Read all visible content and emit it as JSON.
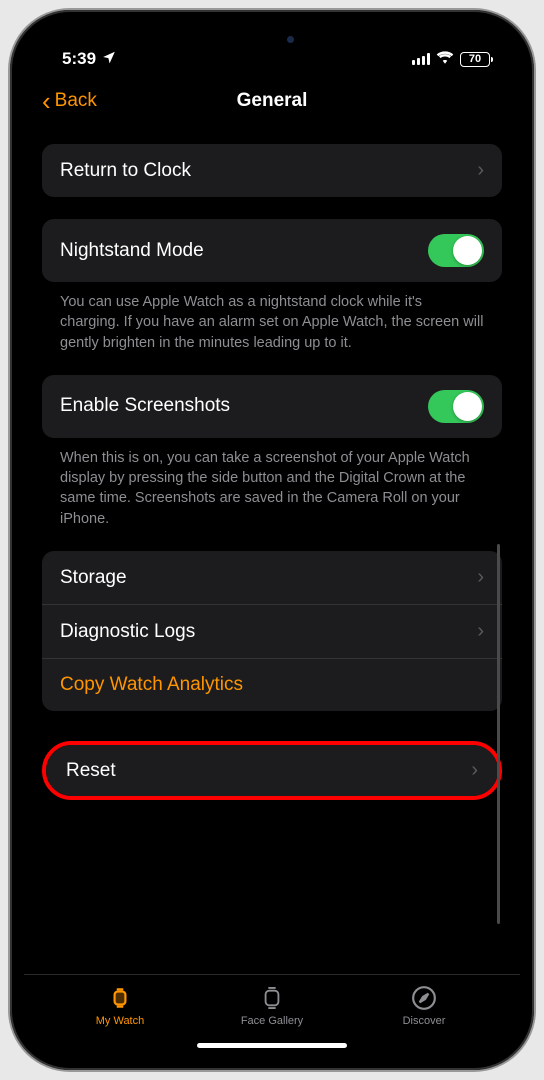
{
  "status": {
    "time": "5:39",
    "battery": "70"
  },
  "nav": {
    "back": "Back",
    "title": "General"
  },
  "sections": {
    "return_to_clock": "Return to Clock",
    "nightstand": {
      "label": "Nightstand Mode",
      "footer": "You can use Apple Watch as a nightstand clock while it's charging. If you have an alarm set on Apple Watch, the screen will gently brighten in the minutes leading up to it."
    },
    "screenshots": {
      "label": "Enable Screenshots",
      "footer": "When this is on, you can take a screenshot of your Apple Watch display by pressing the side button and the Digital Crown at the same time. Screenshots are saved in the Camera Roll on your iPhone."
    },
    "storage": "Storage",
    "diagnostic": "Diagnostic Logs",
    "analytics": "Copy Watch Analytics",
    "reset": "Reset"
  },
  "tabs": {
    "my_watch": "My Watch",
    "face_gallery": "Face Gallery",
    "discover": "Discover"
  }
}
